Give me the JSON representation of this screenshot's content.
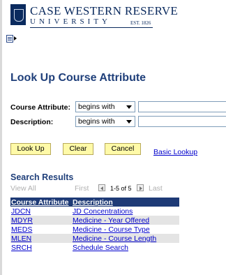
{
  "logo": {
    "line1": "CASE WESTERN RESERVE",
    "line2": "UNIVERSITY",
    "est": "EST. 1826"
  },
  "page": {
    "title": "Look Up Course Attribute"
  },
  "search": {
    "fields": [
      {
        "label": "Course Attribute:",
        "operator": "begins with",
        "value": ""
      },
      {
        "label": "Description:",
        "operator": "begins with",
        "value": ""
      }
    ],
    "buttons": {
      "lookup": "Look Up",
      "clear": "Clear",
      "cancel": "Cancel"
    },
    "basic_lookup": "Basic Lookup"
  },
  "results": {
    "title": "Search Results",
    "view_all": "View All",
    "first": "First",
    "count": "1-5 of 5",
    "last": "Last",
    "columns": [
      "Course Attribute",
      "Description"
    ],
    "rows": [
      {
        "code": "JDCN",
        "desc": "JD Concentrations"
      },
      {
        "code": "MDYR",
        "desc": "Medicine - Year Offered"
      },
      {
        "code": "MEDS",
        "desc": "Medicine - Course Type"
      },
      {
        "code": "MLEN",
        "desc": "Medicine - Course Length"
      },
      {
        "code": "SRCH",
        "desc": "Schedule Search"
      }
    ]
  },
  "colors": {
    "title": "#1f3f7a",
    "header_bg": "#1e3a76",
    "button_bg": "#fffaa8",
    "link": "#0000cc",
    "row_alt": "#e4e4e4"
  }
}
